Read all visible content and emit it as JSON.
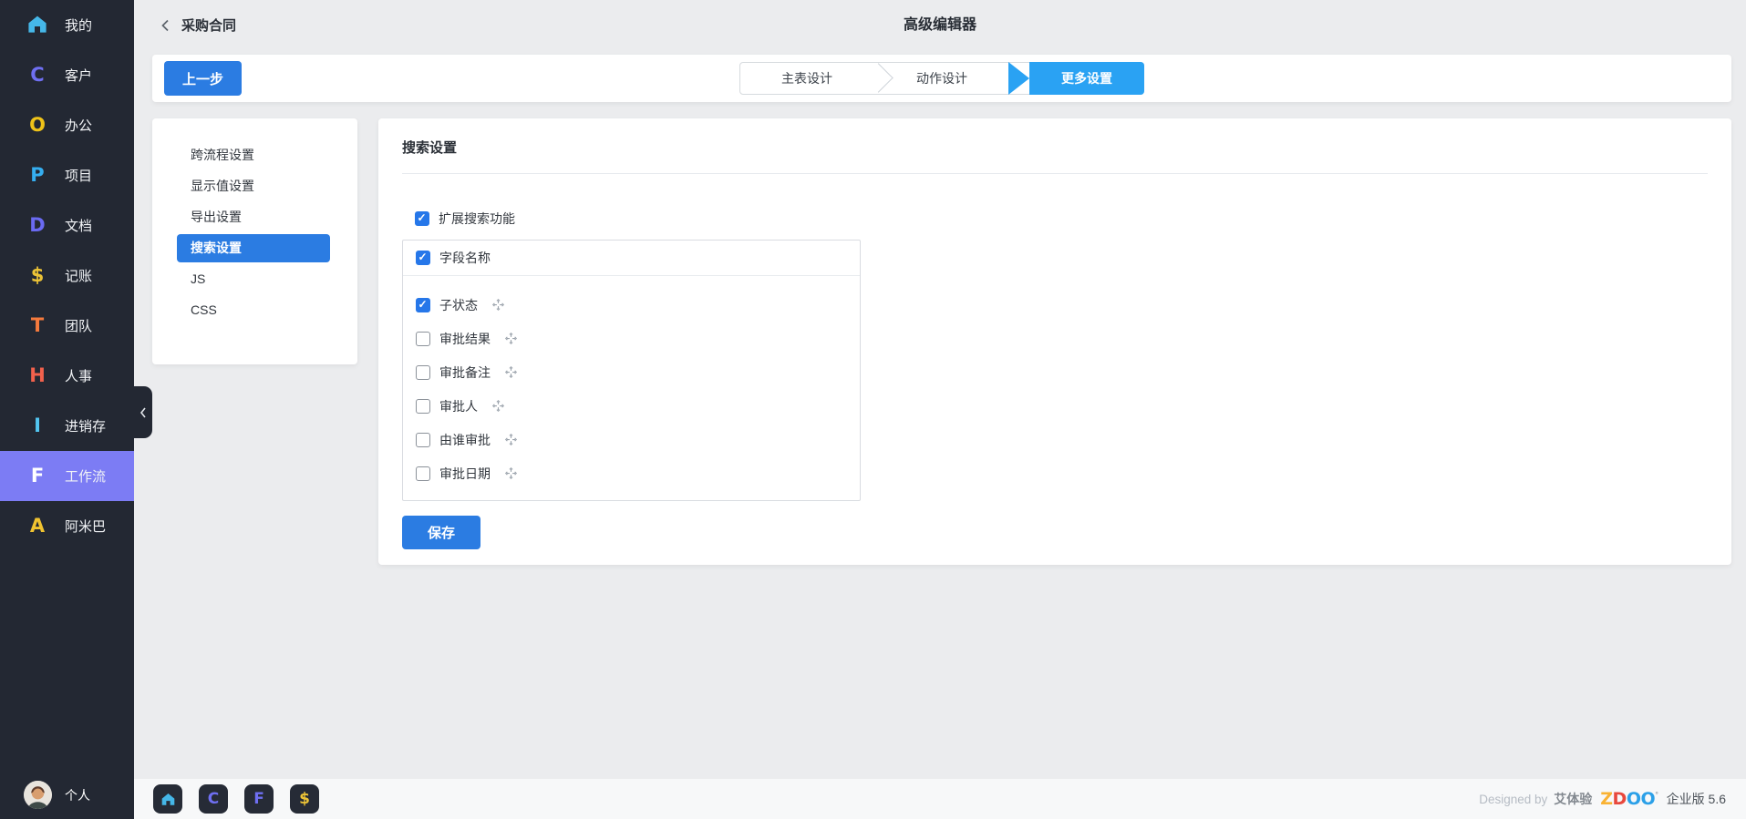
{
  "sidebar": {
    "items": [
      {
        "label": "我的",
        "icon": "home",
        "color": "#45b7e8",
        "active": false
      },
      {
        "label": "客户",
        "glyph": "C",
        "color": "#6f6ff2",
        "active": false
      },
      {
        "label": "办公",
        "glyph": "O",
        "color": "#efc319",
        "active": false
      },
      {
        "label": "项目",
        "glyph": "P",
        "color": "#35aef0",
        "active": false
      },
      {
        "label": "文档",
        "glyph": "D",
        "color": "#6a6af2",
        "active": false
      },
      {
        "label": "记账",
        "glyph": "$",
        "color": "#ecc336",
        "active": false
      },
      {
        "label": "团队",
        "glyph": "T",
        "color": "#f57a3d",
        "active": false
      },
      {
        "label": "人事",
        "glyph": "H",
        "color": "#f2614c",
        "active": false
      },
      {
        "label": "进销存",
        "glyph": "I",
        "color": "#52c5f0",
        "active": false
      },
      {
        "label": "工作流",
        "glyph": "F",
        "color": "#ffffff",
        "active": true
      },
      {
        "label": "阿米巴",
        "glyph": "A",
        "color": "#f0c330",
        "active": false
      }
    ],
    "user_label": "个人"
  },
  "header": {
    "back_title": "采购合同",
    "page_title": "高级编辑器"
  },
  "toolbar": {
    "prev_button": "上一步",
    "steps": [
      {
        "label": "主表设计",
        "active": false
      },
      {
        "label": "动作设计",
        "active": false
      },
      {
        "label": "更多设置",
        "active": true
      }
    ]
  },
  "settings_nav": {
    "items": [
      {
        "label": "跨流程设置",
        "active": false
      },
      {
        "label": "显示值设置",
        "active": false
      },
      {
        "label": "导出设置",
        "active": false
      },
      {
        "label": "搜索设置",
        "active": true
      },
      {
        "label": "JS",
        "active": false
      },
      {
        "label": "CSS",
        "active": false
      }
    ]
  },
  "panel": {
    "title": "搜索设置",
    "enable_label": "扩展搜索功能",
    "enable_checked": true,
    "field_header": {
      "label": "字段名称",
      "checked": true
    },
    "fields": [
      {
        "label": "子状态",
        "checked": true
      },
      {
        "label": "审批结果",
        "checked": false
      },
      {
        "label": "审批备注",
        "checked": false
      },
      {
        "label": "审批人",
        "checked": false
      },
      {
        "label": "由谁审批",
        "checked": false
      },
      {
        "label": "审批日期",
        "checked": false
      }
    ],
    "save_button": "保存"
  },
  "taskbar": {
    "apps": [
      {
        "name": "home",
        "color": "#45b7e8"
      },
      {
        "name": "客户",
        "glyph": "C",
        "color": "#6f6ff2"
      },
      {
        "name": "工作流",
        "glyph": "F",
        "color": "#6f6ff2"
      },
      {
        "name": "记账",
        "glyph": "$",
        "color": "#ecc336"
      }
    ],
    "credit_prefix": "Designed by",
    "credit_brand": "艾体验",
    "logo": {
      "z": "Z",
      "d": "D",
      "oo": "OO"
    },
    "edition": "企业版 5.6"
  },
  "colors": {
    "primary_button": "#2b7ce2",
    "step_active": "#2aa2f3",
    "sidebar_bg": "#232833",
    "sidebar_active": "#7c7cf4",
    "checkbox": "#2677e9"
  }
}
